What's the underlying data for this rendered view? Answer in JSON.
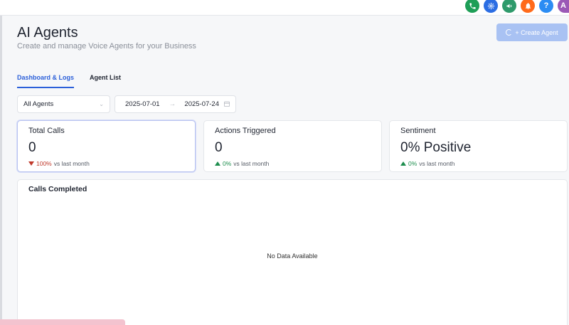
{
  "header": {
    "icons": [
      "phone-icon",
      "gear-icon",
      "megaphone-icon",
      "bell-icon",
      "help-icon",
      "avatar"
    ],
    "avatar_initial": "A",
    "help_label": "?"
  },
  "page": {
    "title": "AI Agents",
    "subtitle": "Create and manage Voice Agents for your Business",
    "create_button": "+ Create Agent"
  },
  "tabs": [
    {
      "label": "Dashboard & Logs",
      "active": true
    },
    {
      "label": "Agent List",
      "active": false
    }
  ],
  "filters": {
    "agent_select": "All Agents",
    "start_date": "2025-07-01",
    "end_date": "2025-07-24"
  },
  "stats": [
    {
      "label": "Total Calls",
      "value": "0",
      "change": "100%",
      "direction": "down",
      "suffix": "vs last month"
    },
    {
      "label": "Actions Triggered",
      "value": "0",
      "change": "0%",
      "direction": "up",
      "suffix": "vs last month"
    },
    {
      "label": "Sentiment",
      "value": "0% Positive",
      "change": "0%",
      "direction": "up",
      "suffix": "vs last month"
    }
  ],
  "calls_panel": {
    "title": "Calls Completed",
    "empty_text": "No Data Available"
  },
  "colors": {
    "accent": "#2b5fd9",
    "create_button_bg": "#a9c2f3",
    "down": "#c0392b",
    "up": "#1e8e4e"
  }
}
